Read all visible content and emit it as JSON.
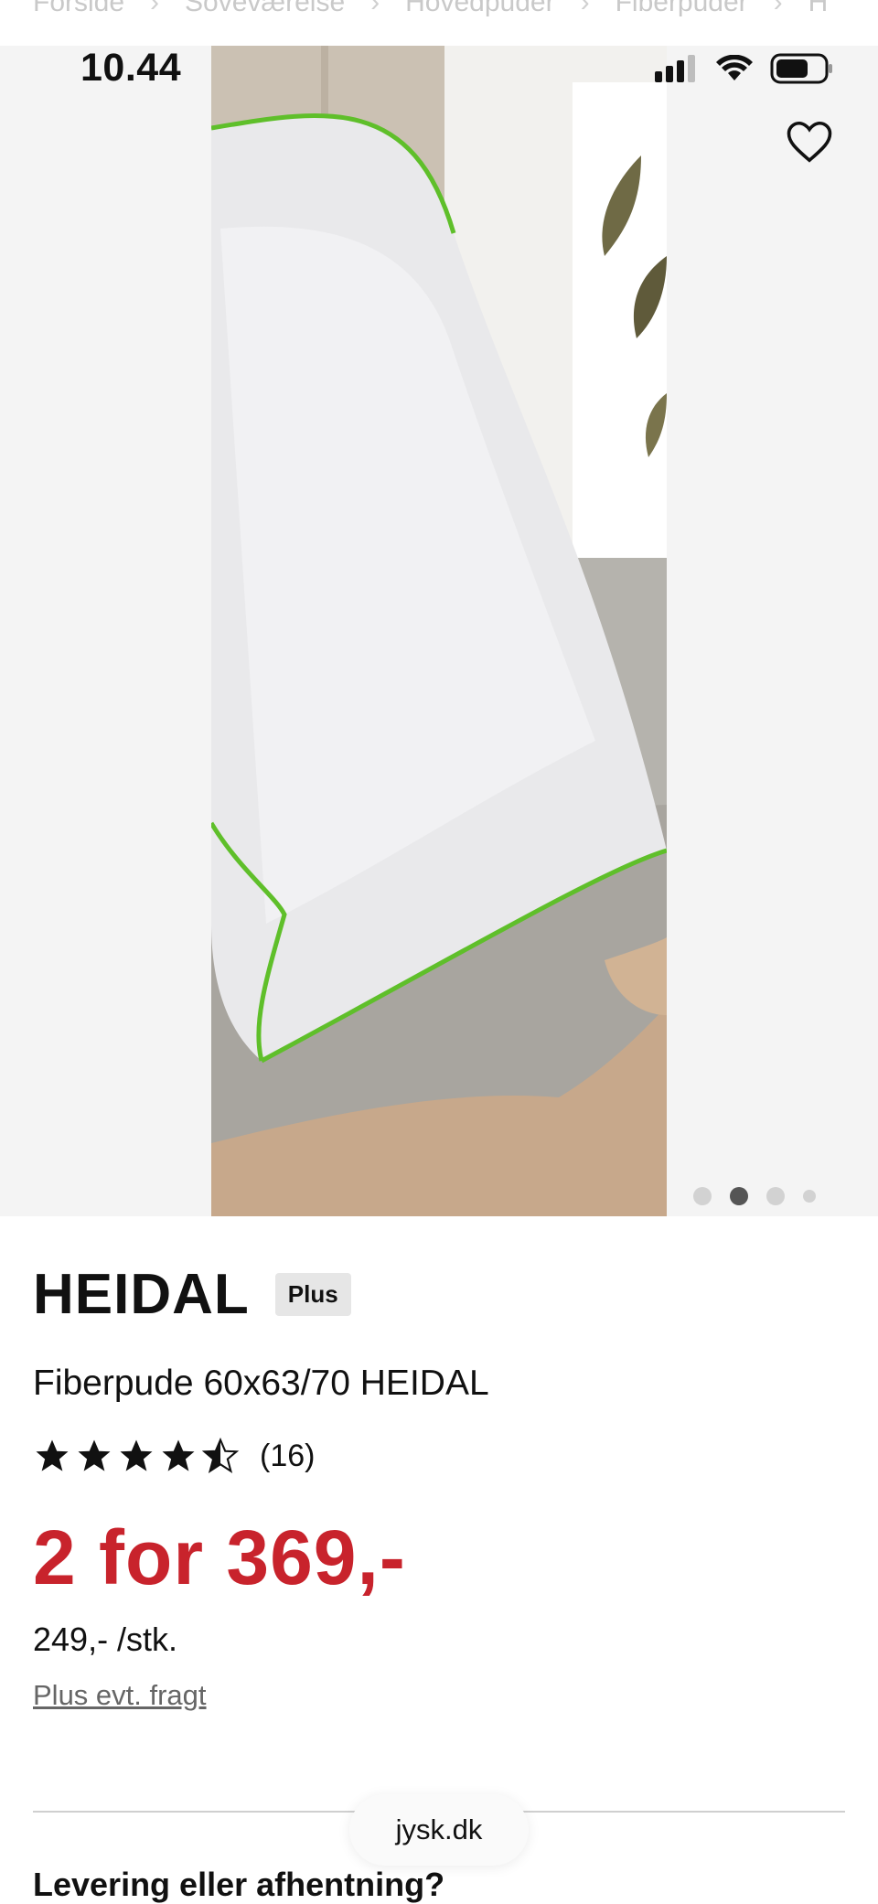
{
  "breadcrumb": [
    "Forside",
    "Soveværelse",
    "Hovedpuder",
    "Fiberpuder",
    "H"
  ],
  "status": {
    "time": "10.44"
  },
  "gallery": {
    "image": "pillow-on-bed-photo",
    "dots": 4,
    "active_dot": 2
  },
  "product": {
    "brand": "HEIDAL",
    "badge": "Plus",
    "name": "Fiberpude 60x63/70 HEIDAL",
    "rating": 4.5,
    "review_count": "(16)",
    "price": "2 for 369,-",
    "unit_price": "249,- /stk.",
    "freight_link": "Plus evt. fragt"
  },
  "browser": {
    "url": "jysk.dk"
  },
  "delivery": {
    "heading": "Levering eller afhentning?"
  },
  "colors": {
    "price_red": "#c8232c",
    "pillow_trim_green": "#5fbf2a"
  }
}
